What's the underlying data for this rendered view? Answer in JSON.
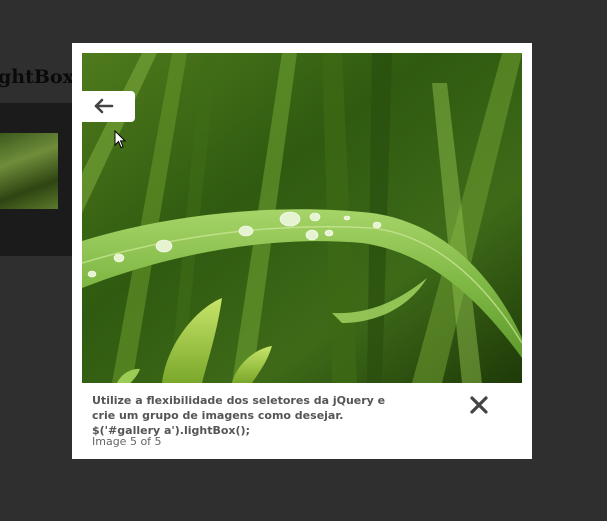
{
  "background": {
    "title": "ghtBox p",
    "gallery_thumbnail": "grass-thumbnail"
  },
  "lightbox": {
    "image": "green grass blade with water droplets",
    "prev_icon": "arrow-left-icon",
    "close_icon": "close-x-icon",
    "caption": "Utilize a flexibilidade dos seletores da jQuery e crie um grupo de imagens como desejar. $('#gallery a').lightBox();",
    "image_number": "Image 5 of 5"
  },
  "colors": {
    "overlay": "#2f2f2f",
    "frame": "#ffffff",
    "caption_text": "#555555",
    "icon": "#444444"
  }
}
